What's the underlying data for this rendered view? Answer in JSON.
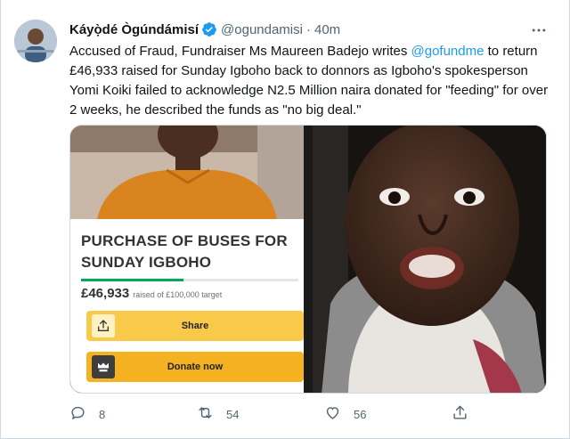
{
  "tweet": {
    "author": {
      "display_name": "Káyọ̀dé Ògúndámisí",
      "handle": "@ogundamisi",
      "verified": true
    },
    "separator": "·",
    "timestamp": "40m",
    "text": {
      "part1": "Accused of Fraud, Fundraiser Ms Maureen Badejo writes ",
      "mention": "@gofundme",
      "part2": " to return £46,933 raised for Sunday Igboho back to donnors as Igboho's spokesperson Yomi Koiki failed to acknowledge N2.5 Million naira donated for \"feeding\" for over 2 weeks, he described the funds as \"no big deal.\""
    },
    "media": {
      "left_panel": {
        "campaign_title": "PURCHASE OF BUSES FOR SUNDAY IGBOHO",
        "amount_raised": "£46,933",
        "target_text": "raised of £100,000 target",
        "progress_fraction": 0.47,
        "share_label": "Share",
        "donate_label": "Donate now"
      }
    },
    "actions": {
      "replies": "8",
      "retweets": "54",
      "likes": "56"
    }
  },
  "colors": {
    "accent": "#1d9bf0",
    "secondary_text": "#536471",
    "gofundme_green": "#02a95c",
    "gofundme_yellow": "#f5c33b"
  },
  "icons": [
    "verified-badge-icon",
    "more-options-icon",
    "reply-icon",
    "retweet-icon",
    "like-icon",
    "share-icon",
    "upload-icon",
    "gofundme-logo-icon"
  ]
}
